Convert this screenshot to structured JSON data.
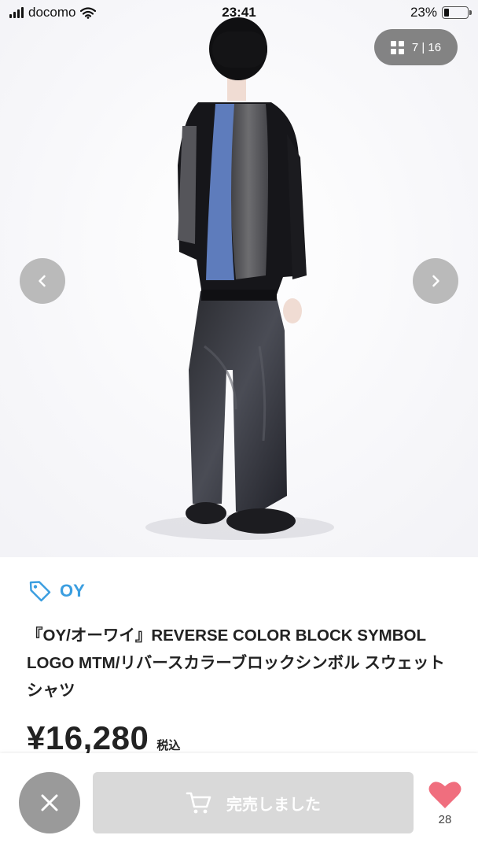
{
  "status_bar": {
    "carrier": "docomo",
    "time": "23:41",
    "battery_percent": "23%",
    "battery_level": 0.23
  },
  "gallery": {
    "counter_text": "7 | 16",
    "image_description": "model wearing black color block sweatshirt and dark wide jeans, back view"
  },
  "product": {
    "brand": "OY",
    "title": "『OY/オーワイ』REVERSE COLOR BLOCK SYMBOL LOGO MTM/リバースカラーブロックシンボル スウェットシャツ",
    "price": "¥16,280",
    "tax_label": "税込"
  },
  "actions": {
    "sold_out_label": "完売しました",
    "like_count": "28"
  },
  "colors": {
    "brand_blue": "#3b9ee0",
    "like_heart": "#f06e7e",
    "sold_button": "#d9d9d9"
  }
}
